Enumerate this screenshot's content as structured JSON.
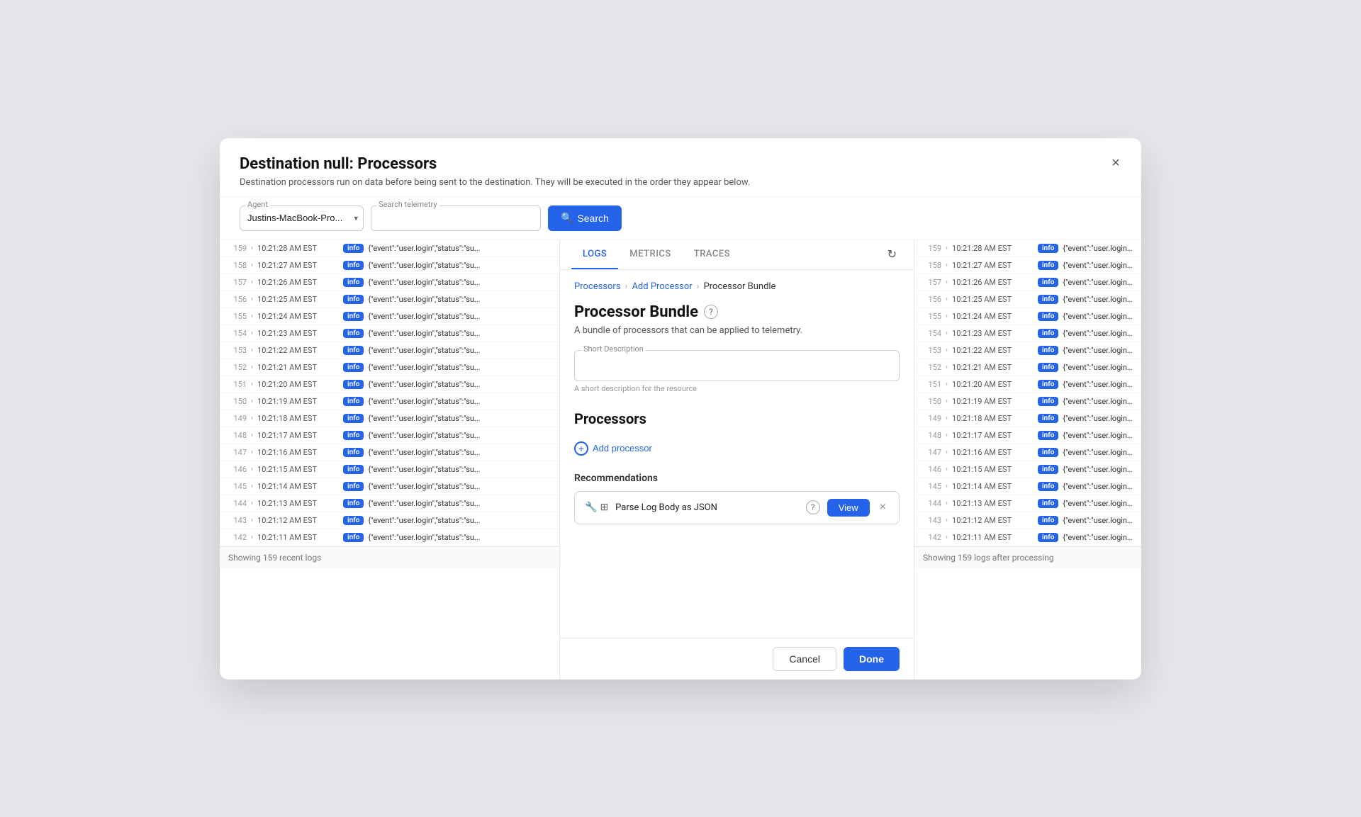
{
  "modal": {
    "title": "Destination null: Processors",
    "subtitle": "Destination processors run on data before being sent to the destination. They will be executed in the order they appear below.",
    "close_label": "×"
  },
  "toolbar": {
    "agent_label": "Agent",
    "agent_value": "Justins-MacBook-Pro...",
    "search_label": "Search telemetry",
    "search_placeholder": "",
    "search_button": "Search"
  },
  "tabs": [
    {
      "id": "logs",
      "label": "LOGS",
      "active": true
    },
    {
      "id": "metrics",
      "label": "METRICS",
      "active": false
    },
    {
      "id": "traces",
      "label": "TRACES",
      "active": false
    }
  ],
  "breadcrumb": {
    "processors": "Processors",
    "add_processor": "Add Processor",
    "current": "Processor Bundle"
  },
  "processor_bundle": {
    "title": "Processor Bundle",
    "description": "A bundle of processors that can be applied to telemetry.",
    "short_description_label": "Short Description",
    "short_description_placeholder": "",
    "short_description_hint": "A short description for the resource",
    "processors_title": "Processors",
    "add_processor_label": "Add processor",
    "recommendations_title": "Recommendations",
    "recommendation": {
      "name": "Parse Log Body as JSON",
      "view_label": "View",
      "dismiss_label": "×"
    }
  },
  "footer": {
    "cancel_label": "Cancel",
    "done_label": "Done"
  },
  "left_logs": {
    "rows": [
      {
        "num": "159",
        "time": "10:21:28 AM EST",
        "badge": "info",
        "text": "{\"event\":\"user.login\",\"status\":\"su..."
      },
      {
        "num": "158",
        "time": "10:21:27 AM EST",
        "badge": "info",
        "text": "{\"event\":\"user.login\",\"status\":\"su..."
      },
      {
        "num": "157",
        "time": "10:21:26 AM EST",
        "badge": "info",
        "text": "{\"event\":\"user.login\",\"status\":\"su..."
      },
      {
        "num": "156",
        "time": "10:21:25 AM EST",
        "badge": "info",
        "text": "{\"event\":\"user.login\",\"status\":\"su..."
      },
      {
        "num": "155",
        "time": "10:21:24 AM EST",
        "badge": "info",
        "text": "{\"event\":\"user.login\",\"status\":\"su..."
      },
      {
        "num": "154",
        "time": "10:21:23 AM EST",
        "badge": "info",
        "text": "{\"event\":\"user.login\",\"status\":\"su..."
      },
      {
        "num": "153",
        "time": "10:21:22 AM EST",
        "badge": "info",
        "text": "{\"event\":\"user.login\",\"status\":\"su..."
      },
      {
        "num": "152",
        "time": "10:21:21 AM EST",
        "badge": "info",
        "text": "{\"event\":\"user.login\",\"status\":\"su..."
      },
      {
        "num": "151",
        "time": "10:21:20 AM EST",
        "badge": "info",
        "text": "{\"event\":\"user.login\",\"status\":\"su..."
      },
      {
        "num": "150",
        "time": "10:21:19 AM EST",
        "badge": "info",
        "text": "{\"event\":\"user.login\",\"status\":\"su..."
      },
      {
        "num": "149",
        "time": "10:21:18 AM EST",
        "badge": "info",
        "text": "{\"event\":\"user.login\",\"status\":\"su..."
      },
      {
        "num": "148",
        "time": "10:21:17 AM EST",
        "badge": "info",
        "text": "{\"event\":\"user.login\",\"status\":\"su..."
      },
      {
        "num": "147",
        "time": "10:21:16 AM EST",
        "badge": "info",
        "text": "{\"event\":\"user.login\",\"status\":\"su..."
      },
      {
        "num": "146",
        "time": "10:21:15 AM EST",
        "badge": "info",
        "text": "{\"event\":\"user.login\",\"status\":\"su..."
      },
      {
        "num": "145",
        "time": "10:21:14 AM EST",
        "badge": "info",
        "text": "{\"event\":\"user.login\",\"status\":\"su..."
      },
      {
        "num": "144",
        "time": "10:21:13 AM EST",
        "badge": "info",
        "text": "{\"event\":\"user.login\",\"status\":\"su..."
      },
      {
        "num": "143",
        "time": "10:21:12 AM EST",
        "badge": "info",
        "text": "{\"event\":\"user.login\",\"status\":\"su..."
      },
      {
        "num": "142",
        "time": "10:21:11 AM EST",
        "badge": "info",
        "text": "{\"event\":\"user.login\",\"status\":\"su..."
      }
    ],
    "footer": "Showing 159 recent logs"
  },
  "right_logs": {
    "rows": [
      {
        "num": "159",
        "time": "10:21:28 AM EST",
        "badge": "info",
        "text": "{\"event\":\"user.login\\..."
      },
      {
        "num": "158",
        "time": "10:21:27 AM EST",
        "badge": "info",
        "text": "{\"event\":\"user.login\\..."
      },
      {
        "num": "157",
        "time": "10:21:26 AM EST",
        "badge": "info",
        "text": "{\"event\":\"user.login\\..."
      },
      {
        "num": "156",
        "time": "10:21:25 AM EST",
        "badge": "info",
        "text": "{\"event\":\"user.login\\..."
      },
      {
        "num": "155",
        "time": "10:21:24 AM EST",
        "badge": "info",
        "text": "{\"event\":\"user.login\\..."
      },
      {
        "num": "154",
        "time": "10:21:23 AM EST",
        "badge": "info",
        "text": "{\"event\":\"user.login\\..."
      },
      {
        "num": "153",
        "time": "10:21:22 AM EST",
        "badge": "info",
        "text": "{\"event\":\"user.login\\..."
      },
      {
        "num": "152",
        "time": "10:21:21 AM EST",
        "badge": "info",
        "text": "{\"event\":\"user.login\\..."
      },
      {
        "num": "151",
        "time": "10:21:20 AM EST",
        "badge": "info",
        "text": "{\"event\":\"user.login\\..."
      },
      {
        "num": "150",
        "time": "10:21:19 AM EST",
        "badge": "info",
        "text": "{\"event\":\"user.login\\..."
      },
      {
        "num": "149",
        "time": "10:21:18 AM EST",
        "badge": "info",
        "text": "{\"event\":\"user.login\\..."
      },
      {
        "num": "148",
        "time": "10:21:17 AM EST",
        "badge": "info",
        "text": "{\"event\":\"user.login\\..."
      },
      {
        "num": "147",
        "time": "10:21:16 AM EST",
        "badge": "info",
        "text": "{\"event\":\"user.login\\..."
      },
      {
        "num": "146",
        "time": "10:21:15 AM EST",
        "badge": "info",
        "text": "{\"event\":\"user.login\\..."
      },
      {
        "num": "145",
        "time": "10:21:14 AM EST",
        "badge": "info",
        "text": "{\"event\":\"user.login\\..."
      },
      {
        "num": "144",
        "time": "10:21:13 AM EST",
        "badge": "info",
        "text": "{\"event\":\"user.login\\..."
      },
      {
        "num": "143",
        "time": "10:21:12 AM EST",
        "badge": "info",
        "text": "{\"event\":\"user.login\\..."
      },
      {
        "num": "142",
        "time": "10:21:11 AM EST",
        "badge": "info",
        "text": "{\"event\":\"user.login\\..."
      }
    ],
    "footer": "Showing 159 logs after processing"
  }
}
